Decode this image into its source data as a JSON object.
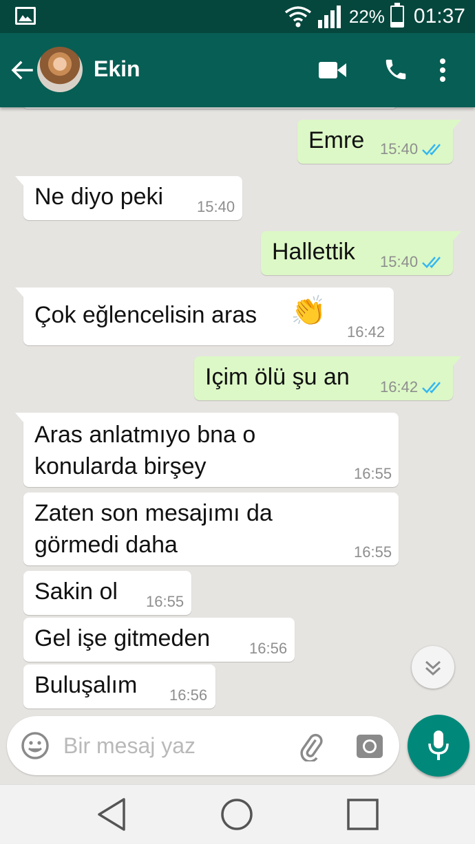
{
  "status_bar": {
    "battery_percent": "22%",
    "battery_level": 0.22,
    "time": "01:37",
    "icons": [
      "image-icon",
      "wifi-icon",
      "signal-icon",
      "battery-icon"
    ]
  },
  "app_bar": {
    "contact_name": "Ekin",
    "icons": [
      "back-arrow-icon",
      "avatar",
      "video-call-icon",
      "phone-icon",
      "more-vert-icon"
    ]
  },
  "messages": [
    {
      "dir": "out",
      "text": "Emre",
      "time": "15:40",
      "read": true
    },
    {
      "dir": "in",
      "text": "Ne diyo peki",
      "time": "15:40"
    },
    {
      "dir": "out",
      "text": "Hallettik",
      "time": "15:40",
      "read": true
    },
    {
      "dir": "in",
      "text": "Çok eğlencelisin aras",
      "emoji": "👏",
      "time": "16:42"
    },
    {
      "dir": "out",
      "text": "Içim ölü şu an",
      "time": "16:42",
      "read": true
    },
    {
      "dir": "in",
      "lines": [
        "Aras anlatmıyo bna o",
        "konularda birşey"
      ],
      "time": "16:55"
    },
    {
      "dir": "in",
      "lines": [
        "Zaten son mesajımı da",
        "görmedi daha"
      ],
      "time": "16:55"
    },
    {
      "dir": "in",
      "text": "Sakin ol",
      "time": "16:55"
    },
    {
      "dir": "in",
      "text": "Gel işe gitmeden",
      "time": "16:56"
    },
    {
      "dir": "in",
      "text": "Buluşalım",
      "time": "16:56"
    }
  ],
  "input": {
    "placeholder": "Bir mesaj yaz",
    "value": ""
  },
  "colors": {
    "header": "#075e54",
    "status_bar": "#06473d",
    "outgoing_bubble": "#dcf8c6",
    "incoming_bubble": "#ffffff",
    "chat_bg": "#e6e4e1",
    "mic_button": "#00897b",
    "read_ticks": "#34b7f1"
  },
  "nav_icons": [
    "back-triangle-icon",
    "home-circle-icon",
    "recents-square-icon"
  ]
}
